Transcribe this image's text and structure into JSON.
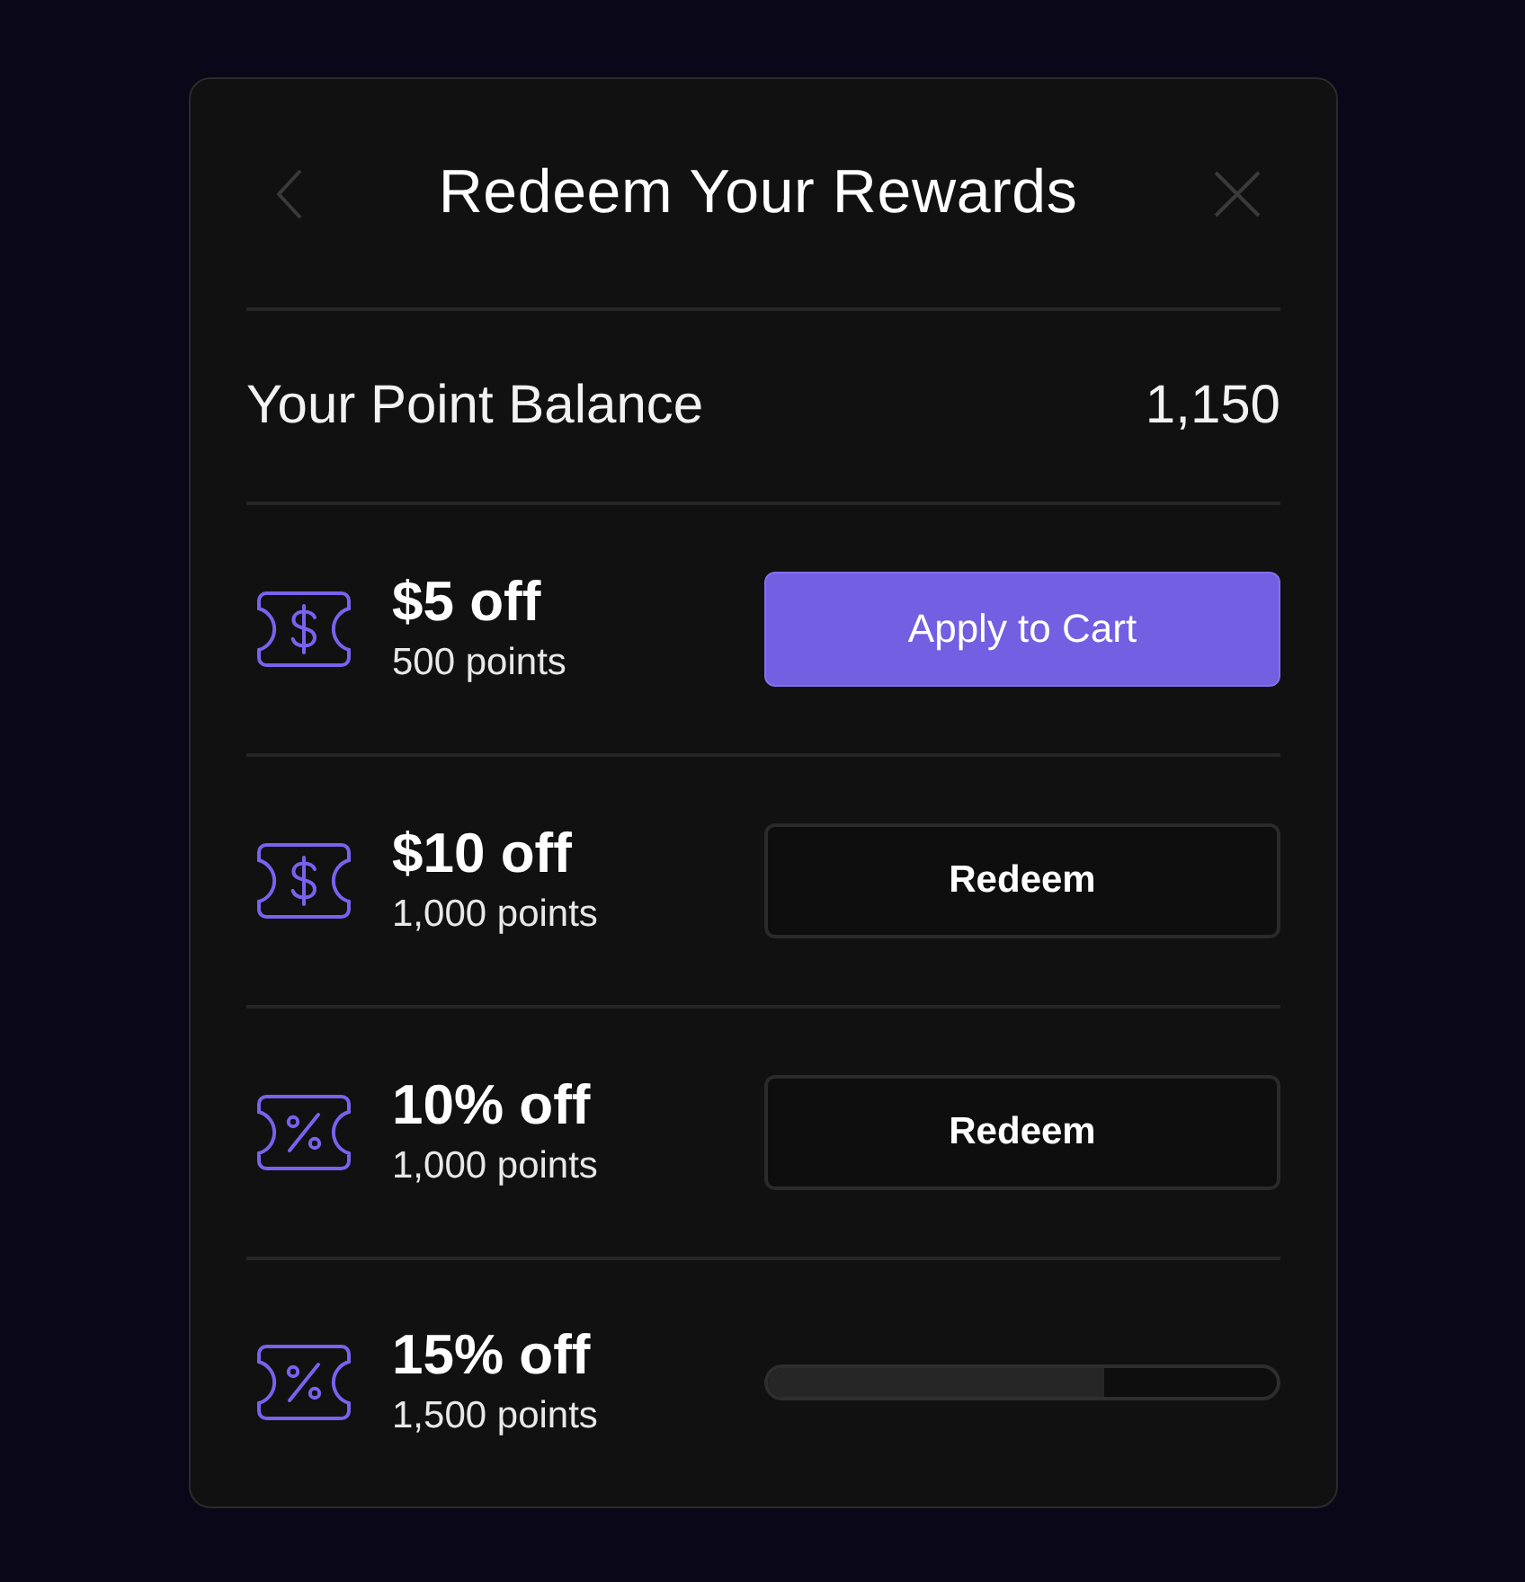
{
  "dialog": {
    "title": "Redeem Your Rewards"
  },
  "balance": {
    "label": "Your Point Balance",
    "value": "1,150"
  },
  "rewards": [
    {
      "kind": "dollar",
      "title": "$5 off",
      "points": "500 points",
      "action": {
        "kind": "apply",
        "label": "Apply to Cart"
      }
    },
    {
      "kind": "dollar",
      "title": "$10 off",
      "points": "1,000 points",
      "action": {
        "kind": "redeem",
        "label": "Redeem"
      }
    },
    {
      "kind": "percent",
      "title": "10% off",
      "points": "1,000 points",
      "action": {
        "kind": "redeem",
        "label": "Redeem"
      }
    },
    {
      "kind": "percent",
      "title": "15% off",
      "points": "1,500 points",
      "action": {
        "kind": "progress",
        "level": 0.66
      }
    }
  ]
}
